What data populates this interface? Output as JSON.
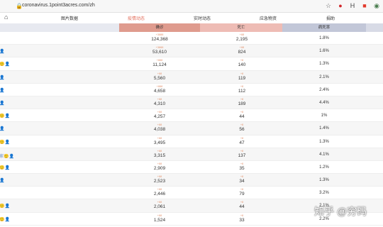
{
  "browser": {
    "url": "coronavirus.1point3acres.com/zh"
  },
  "nav": {
    "tabs": [
      {
        "label": "图片数据",
        "active": false
      },
      {
        "label": "疫情动态",
        "active": true
      },
      {
        "label": "实时动态",
        "active": false
      },
      {
        "label": "应急物资",
        "active": false
      },
      {
        "label": "捐助",
        "active": false
      }
    ]
  },
  "table": {
    "headers": {
      "confirmed": "确诊",
      "deaths": "死亡",
      "fatality_rate": "病死率"
    },
    "rows": [
      {
        "icons": "",
        "confirmed_delta": "+3888",
        "confirmed": "124,368",
        "deaths_delta": "+88",
        "deaths": "2,195",
        "rate": "1.8%"
      },
      {
        "icons": "👤",
        "confirmed_delta": "+3888",
        "confirmed": "53,610",
        "deaths_delta": "+88",
        "deaths": "824",
        "rate": "1.6%"
      },
      {
        "icons": "🙂👤",
        "confirmed_delta": "+888",
        "confirmed": "11,124",
        "deaths_delta": "+8",
        "deaths": "140",
        "rate": "1.3%"
      },
      {
        "icons": "👤",
        "confirmed_delta": "+88",
        "confirmed": "5,560",
        "deaths_delta": "+8",
        "deaths": "119",
        "rate": "2.1%"
      },
      {
        "icons": "👤",
        "confirmed_delta": "+888",
        "confirmed": "4,658",
        "deaths_delta": "+8",
        "deaths": "112",
        "rate": "2.4%"
      },
      {
        "icons": "👤",
        "confirmed_delta": "+88",
        "confirmed": "4,310",
        "deaths_delta": "+8",
        "deaths": "189",
        "rate": "4.4%"
      },
      {
        "icons": "🙂👤",
        "confirmed_delta": "+88",
        "confirmed": "4,257",
        "deaths_delta": "+8",
        "deaths": "44",
        "rate": "1%"
      },
      {
        "icons": "👤",
        "confirmed_delta": "+88",
        "confirmed": "4,038",
        "deaths_delta": "+8",
        "deaths": "56",
        "rate": "1.4%"
      },
      {
        "icons": "🙂👤",
        "confirmed_delta": "+88",
        "confirmed": "3,495",
        "deaths_delta": "+8",
        "deaths": "47",
        "rate": "1.3%"
      },
      {
        "icons": "家🙂👤",
        "confirmed_delta": "+88",
        "confirmed": "3,315",
        "deaths_delta": "+8",
        "deaths": "137",
        "rate": "4.1%"
      },
      {
        "icons": "🙂👤",
        "confirmed_delta": "+88",
        "confirmed": "2,909",
        "deaths_delta": "+8",
        "deaths": "35",
        "rate": "1.2%"
      },
      {
        "icons": "👤",
        "confirmed_delta": "+88",
        "confirmed": "2,523",
        "deaths_delta": "+8",
        "deaths": "34",
        "rate": "1.3%"
      },
      {
        "icons": "",
        "confirmed_delta": "+88",
        "confirmed": "2,446",
        "deaths_delta": "+8",
        "deaths": "79",
        "rate": "3.2%"
      },
      {
        "icons": "🙂👤",
        "confirmed_delta": "+88",
        "confirmed": "2,061",
        "deaths_delta": "+8",
        "deaths": "44",
        "rate": "2.1%"
      },
      {
        "icons": "🙂👤",
        "confirmed_delta": "+88",
        "confirmed": "1,524",
        "deaths_delta": "+8",
        "deaths": "33",
        "rate": "2.2%"
      }
    ]
  },
  "watermark": "知乎 @穷码"
}
